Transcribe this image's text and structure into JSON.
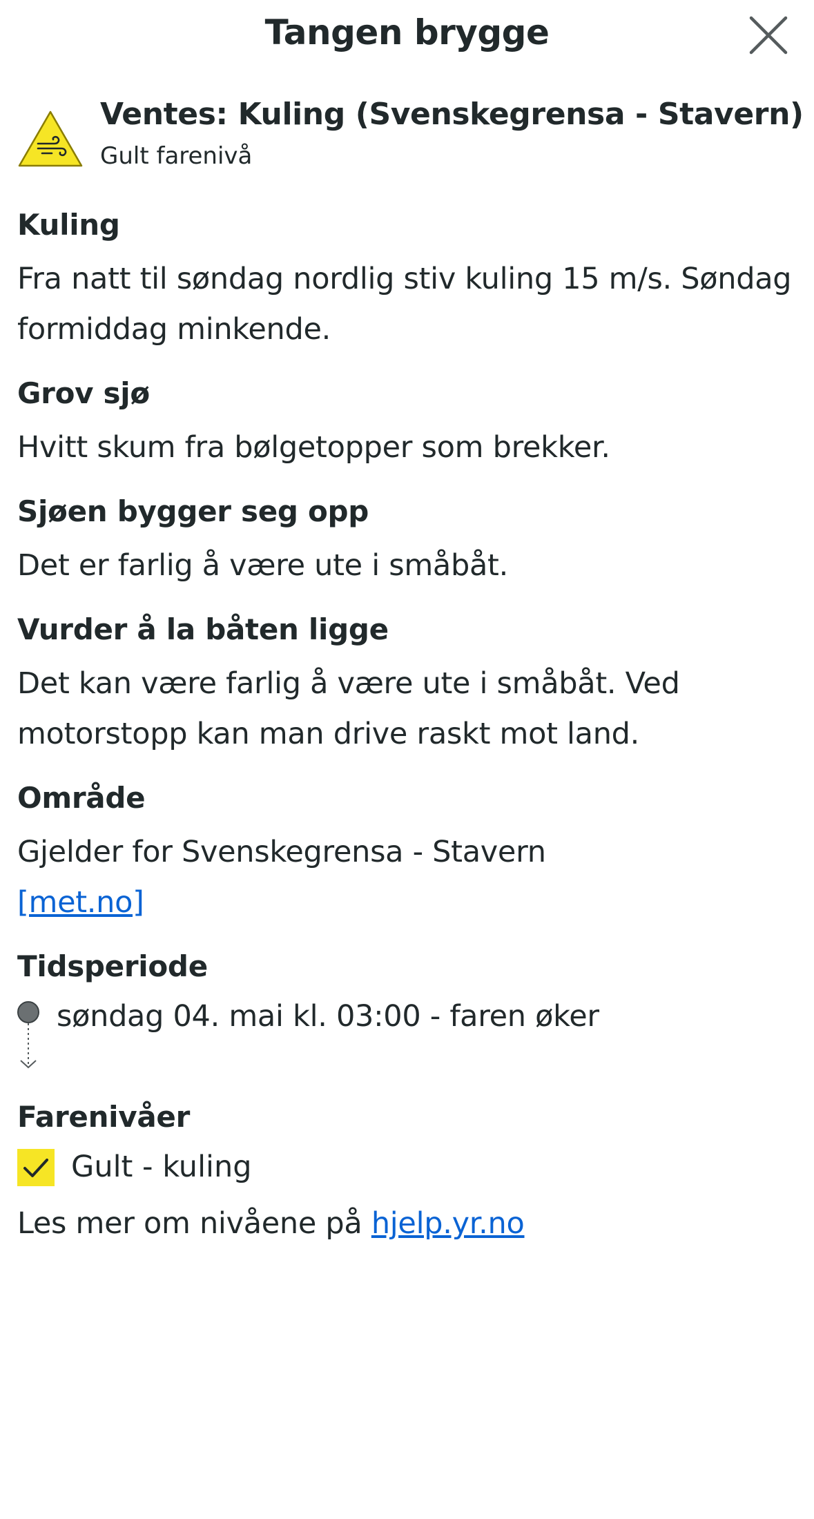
{
  "header": {
    "title": "Tangen brygge",
    "close_icon": "close-icon"
  },
  "warning": {
    "icon": "wind-warning-icon",
    "title": "Ventes: Kuling (Svenskegrensa - Stavern)",
    "level_text": "Gult farenivå",
    "color": "#f6e525"
  },
  "sections": [
    {
      "title": "Kuling",
      "text": "Fra natt til søndag nordlig stiv kuling 15 m/s. Søndag formiddag minkende."
    },
    {
      "title": "Grov sjø",
      "text": "Hvitt skum fra bølgetopper som brekker."
    },
    {
      "title": "Sjøen bygger seg opp",
      "text": "Det er farlig å være ute i småbåt."
    },
    {
      "title": "Vurder å la båten ligge",
      "text": "Det kan være farlig å være ute i småbåt. Ved motorstopp kan man drive raskt mot land."
    }
  ],
  "area": {
    "title": "Område",
    "text": "Gjelder for Svenskegrensa - Stavern",
    "link": "[met.no]"
  },
  "period": {
    "title": "Tidsperiode",
    "start": "søndag 04. mai kl. 03:00 - faren øker"
  },
  "levels": {
    "title": "Farenivåer",
    "items": [
      {
        "label": "Gult - kuling",
        "checked": true
      }
    ],
    "more_prefix": "Les mer om nivåene på ",
    "more_link": "hjelp.yr.no"
  },
  "colors": {
    "text": "#21292b",
    "link": "#0a63d4",
    "yellow": "#f6e525"
  }
}
